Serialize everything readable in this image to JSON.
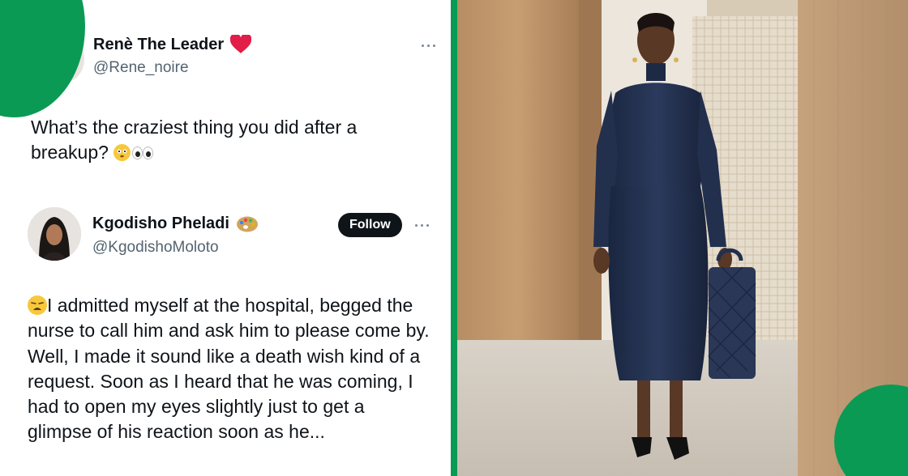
{
  "colors": {
    "accent": "#0a9a54",
    "text_primary": "#0f1419",
    "text_secondary": "#536471",
    "heart": "#e11d48",
    "follow_bg": "#0f1419",
    "dress": "#22304e"
  },
  "post1": {
    "display_name": "Renè The Leader",
    "name_badge_icon": "red-heart-emoji",
    "handle": "@Rene_noire",
    "text": "What’s the craziest thing you did after a breakup?",
    "text_emojis": [
      "flushed-face-emoji",
      "eyes-emoji"
    ]
  },
  "post2": {
    "display_name": "Kgodisho Pheladi",
    "name_badge_icon": "artist-palette-emoji",
    "handle": "@KgodishoMoloto",
    "follow_label": "Follow",
    "leading_emoji": "weary-face-emoji",
    "text": "I admitted myself at the hospital, begged the nurse to call him and ask him to please come by. Well, I made it sound like a death wish kind of a request. Soon as I heard that he was coming, I had to open my eyes slightly just to get a glimpse of his reaction soon as he..."
  },
  "photo": {
    "subject": "woman-in-navy-dress-photo",
    "accessory": "navy-quilted-handbag"
  }
}
